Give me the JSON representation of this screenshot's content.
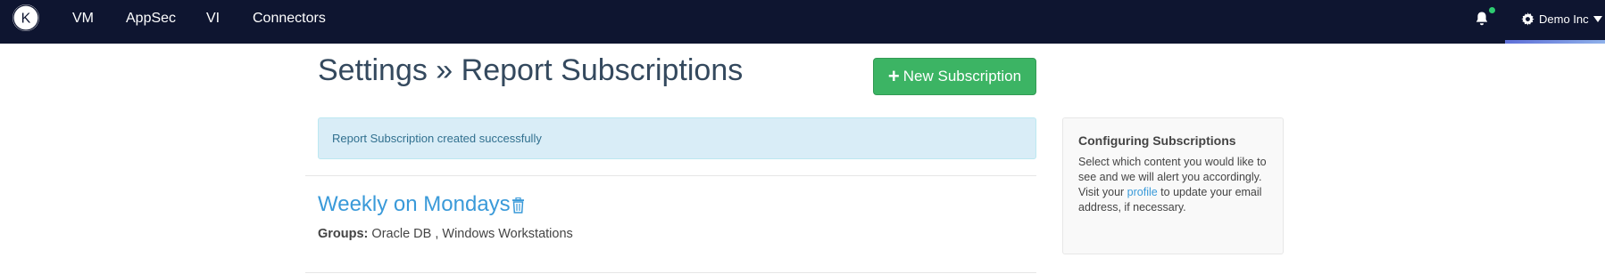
{
  "nav": {
    "logo_letter": "K",
    "links": [
      "VM",
      "AppSec",
      "VI",
      "Connectors"
    ],
    "org_name": "Demo Inc",
    "notification_status_color": "#2ecc71"
  },
  "page": {
    "title": "Settings » Report Subscriptions",
    "new_button_label": "New Subscription"
  },
  "alert": {
    "message": "Report Subscription created successfully"
  },
  "subscription": {
    "name": "Weekly on Mondays",
    "groups_label": "Groups:",
    "groups_value": "Oracle DB , Windows Workstations"
  },
  "info_panel": {
    "title": "Configuring Subscriptions",
    "text_before_link": "Select which content you would like to see and we will alert you accordingly. Visit your ",
    "link_text": "profile",
    "text_after_link": " to update your email address, if necessary."
  },
  "colors": {
    "navbar_bg": "#0e1530",
    "accent_green": "#3cb464",
    "link_blue": "#3a9ad9",
    "alert_bg": "#d9edf7"
  }
}
